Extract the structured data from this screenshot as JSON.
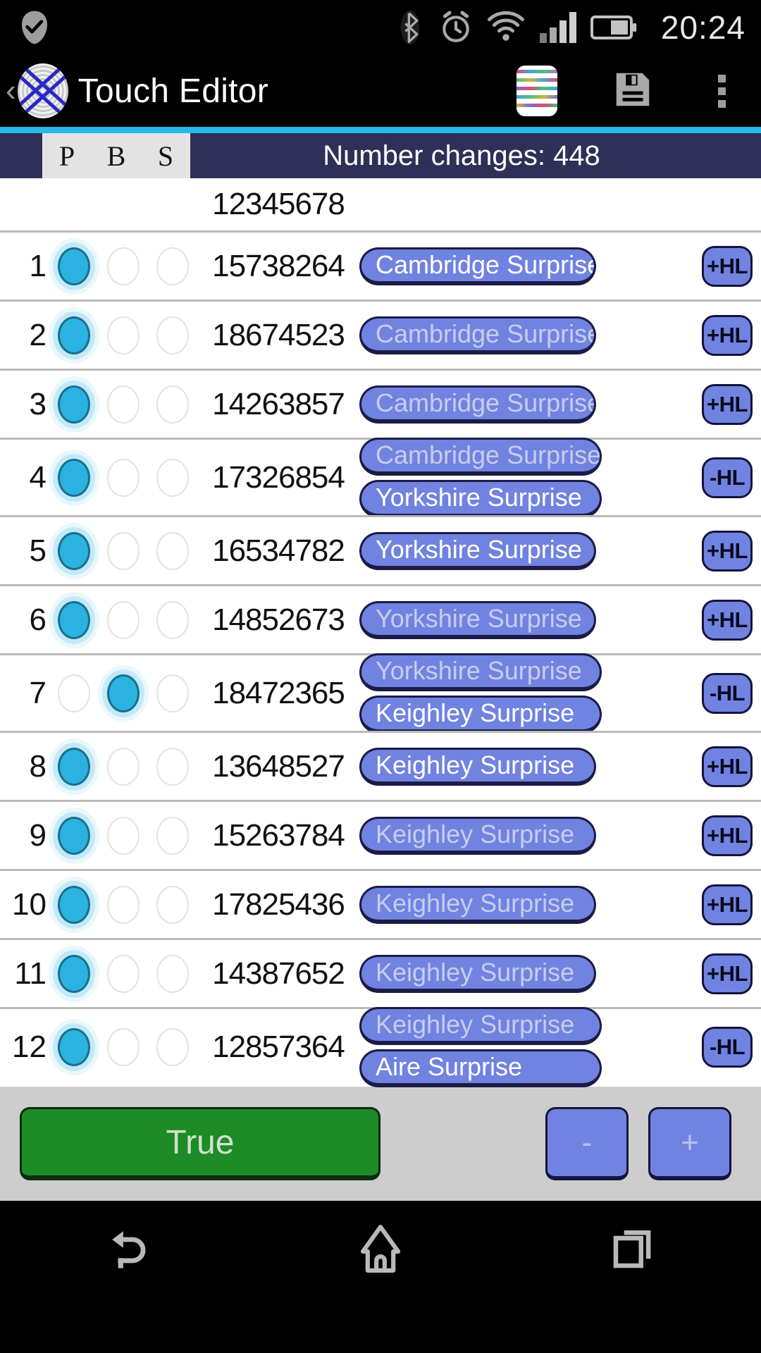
{
  "status_bar": {
    "time": "20:24",
    "icons": [
      "check-badge-icon",
      "bluetooth-icon",
      "alarm-clock-icon",
      "wifi-icon",
      "cellular-signal-icon",
      "battery-icon"
    ]
  },
  "app_bar": {
    "back_label": "‹",
    "logo": "fingerprint-blueline-icon",
    "title": "Touch Editor",
    "actions": [
      {
        "name": "grid-blueline-icon",
        "label": ""
      },
      {
        "name": "save-icon",
        "label": ""
      },
      {
        "name": "overflow-menu-icon",
        "label": ""
      }
    ]
  },
  "table": {
    "columns": [
      "P",
      "B",
      "S"
    ],
    "changes_label": "Number changes: 448",
    "digits_header": "12345678",
    "rows": [
      {
        "n": "1",
        "sel": "P",
        "digits": "15738264",
        "methods": [
          {
            "label": "Cambridge Surprise",
            "dim": false
          }
        ],
        "hl": "+HL"
      },
      {
        "n": "2",
        "sel": "P",
        "digits": "18674523",
        "methods": [
          {
            "label": "Cambridge Surprise",
            "dim": true
          }
        ],
        "hl": "+HL"
      },
      {
        "n": "3",
        "sel": "P",
        "digits": "14263857",
        "methods": [
          {
            "label": "Cambridge Surprise",
            "dim": true
          }
        ],
        "hl": "+HL"
      },
      {
        "n": "4",
        "sel": "P",
        "digits": "17326854",
        "methods": [
          {
            "label": "Cambridge Surprise",
            "dim": true
          },
          {
            "label": "Yorkshire Surprise",
            "dim": false
          }
        ],
        "hl": "-HL"
      },
      {
        "n": "5",
        "sel": "P",
        "digits": "16534782",
        "methods": [
          {
            "label": "Yorkshire Surprise",
            "dim": false
          }
        ],
        "hl": "+HL"
      },
      {
        "n": "6",
        "sel": "P",
        "digits": "14852673",
        "methods": [
          {
            "label": "Yorkshire Surprise",
            "dim": true
          }
        ],
        "hl": "+HL"
      },
      {
        "n": "7",
        "sel": "B",
        "digits": "18472365",
        "methods": [
          {
            "label": "Yorkshire Surprise",
            "dim": true
          },
          {
            "label": "Keighley Surprise",
            "dim": false
          }
        ],
        "hl": "-HL"
      },
      {
        "n": "8",
        "sel": "P",
        "digits": "13648527",
        "methods": [
          {
            "label": "Keighley Surprise",
            "dim": false
          }
        ],
        "hl": "+HL"
      },
      {
        "n": "9",
        "sel": "P",
        "digits": "15263784",
        "methods": [
          {
            "label": "Keighley Surprise",
            "dim": true
          }
        ],
        "hl": "+HL"
      },
      {
        "n": "10",
        "sel": "P",
        "digits": "17825436",
        "methods": [
          {
            "label": "Keighley Surprise",
            "dim": true
          }
        ],
        "hl": "+HL"
      },
      {
        "n": "11",
        "sel": "P",
        "digits": "14387652",
        "methods": [
          {
            "label": "Keighley Surprise",
            "dim": true
          }
        ],
        "hl": "+HL"
      },
      {
        "n": "12",
        "sel": "P",
        "digits": "12857364",
        "methods": [
          {
            "label": "Keighley Surprise",
            "dim": true
          },
          {
            "label": "Aire Surprise",
            "dim": false
          }
        ],
        "hl": "-HL"
      }
    ]
  },
  "controls": {
    "true_label": "True",
    "minus_label": "-",
    "plus_label": "+"
  },
  "nav_bar": {
    "items": [
      "back-nav-icon",
      "home-nav-icon",
      "recents-nav-icon"
    ]
  },
  "colors": {
    "accent": "#29b6e8",
    "header_bg": "#2f3057",
    "method_blue": "#7183e0",
    "true_green": "#1d8b26",
    "radio_on": "#2ab3e0"
  }
}
